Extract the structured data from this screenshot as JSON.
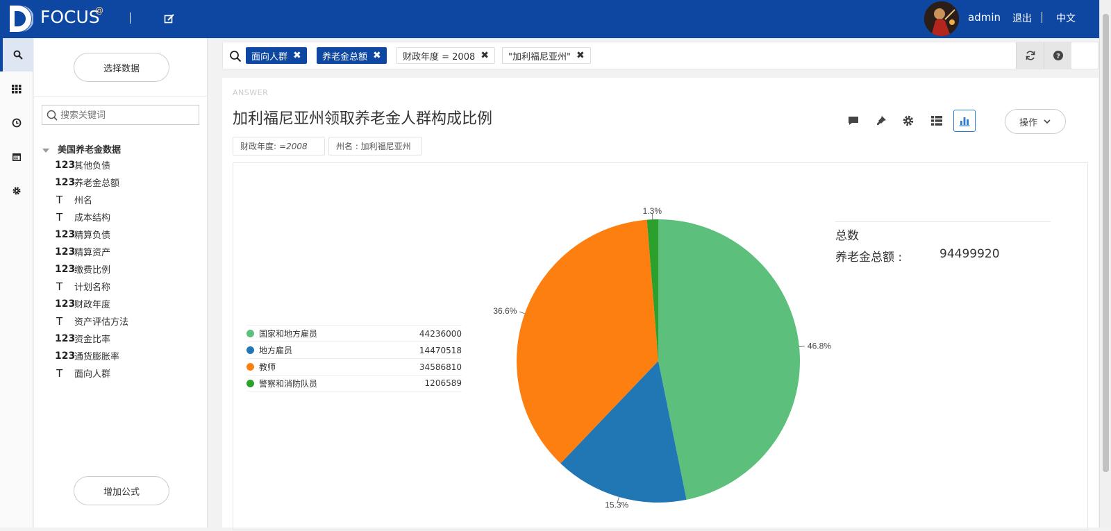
{
  "header": {
    "logo_text": "FOCUS",
    "logo_sup": "@",
    "username": "admin",
    "logout_label": "退出",
    "language_label": "中文"
  },
  "rail": {
    "items": [
      "search-icon",
      "apps-grid-icon",
      "history-clock-icon",
      "calendar-icon",
      "gear-icon"
    ],
    "active": "search-icon"
  },
  "sidebar": {
    "select_data_label": "选择数据",
    "search_placeholder": "搜索关键词",
    "dataset_name": "美国养老金数据",
    "fields": [
      {
        "type": "123",
        "name": "其他负债"
      },
      {
        "type": "123",
        "name": "养老金总额"
      },
      {
        "type": "T",
        "name": "州名"
      },
      {
        "type": "T",
        "name": "成本结构"
      },
      {
        "type": "123",
        "name": "精算负债"
      },
      {
        "type": "123",
        "name": "精算资产"
      },
      {
        "type": "123",
        "name": "缴费比例"
      },
      {
        "type": "T",
        "name": "计划名称"
      },
      {
        "type": "123",
        "name": "财政年度"
      },
      {
        "type": "T",
        "name": "资产评估方法"
      },
      {
        "type": "123",
        "name": "资金比率"
      },
      {
        "type": "123",
        "name": "通货膨胀率"
      },
      {
        "type": "T",
        "name": "面向人群"
      }
    ],
    "add_formula_label": "增加公式"
  },
  "query": {
    "tokens": [
      {
        "label": "面向人群",
        "style": "blue"
      },
      {
        "label": "养老金总额",
        "style": "blue"
      },
      {
        "label": "财政年度 = 2008",
        "style": "plain"
      },
      {
        "label": "\"加利福尼亚州\"",
        "style": "plain"
      }
    ],
    "remove_glyph": "✖"
  },
  "answer": {
    "label": "ANSWER",
    "title": "加利福尼亚州领取养老金人群构成比例",
    "filters": [
      {
        "key": "财政年度:",
        "value": "=2008"
      },
      {
        "key": "州名 : 加利福尼亚州",
        "value": ""
      }
    ],
    "operations_label": "操作",
    "summary": {
      "title": "总数",
      "metric_label": "养老金总额 :",
      "metric_value": "94499920"
    }
  },
  "colors": {
    "brand": "#0d47a1",
    "slice_1": "#5cbf7b",
    "slice_2": "#2176b4",
    "slice_3": "#fd7f10",
    "slice_4": "#2ca02c"
  },
  "chart_data": {
    "type": "pie",
    "categories": [
      "国家和地方雇员",
      "地方雇员",
      "教师",
      "警察和消防队员"
    ],
    "values": [
      44236000,
      14470518,
      34586810,
      1206589
    ],
    "percent_labels": [
      "46.8%",
      "15.3%",
      "36.6%",
      "1.3%"
    ],
    "legend_position": "left",
    "start_angle_deg": 0,
    "direction": "clockwise"
  }
}
